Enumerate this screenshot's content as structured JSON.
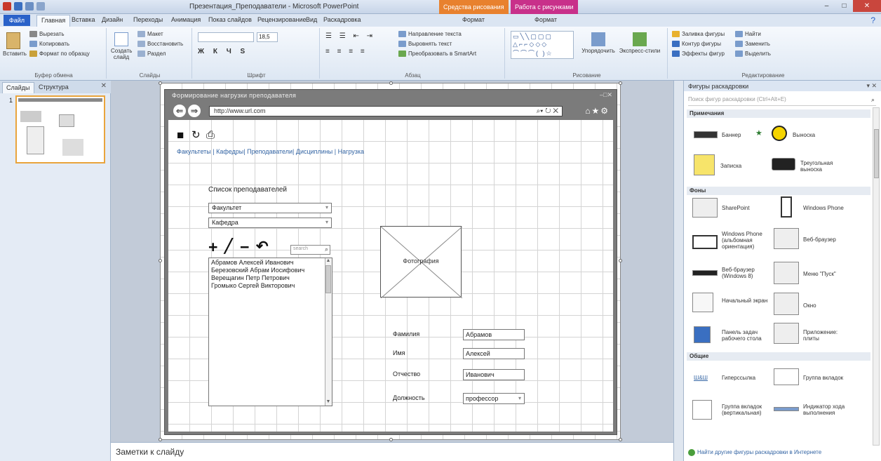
{
  "window": {
    "title": "Презентация_Преподаватели - Microsoft PowerPoint",
    "min": "–",
    "max": "□",
    "close": "✕"
  },
  "context_tabs": [
    "Средства рисования",
    "Работа с рисунками"
  ],
  "tabs": [
    "Файл",
    "Главная",
    "Вставка",
    "Дизайн",
    "Переходы",
    "Анимация",
    "Показ слайдов",
    "Рецензирование",
    "Вид",
    "Раскадровка",
    "Формат",
    "Формат"
  ],
  "ribbon": {
    "clipboard": {
      "label": "Буфер обмена",
      "paste": "Вставить",
      "cut": "Вырезать",
      "copy": "Копировать",
      "format": "Формат по образцу"
    },
    "slides": {
      "label": "Слайды",
      "create": "Создать слайд",
      "layout": "Макет",
      "reset": "Восстановить",
      "section": "Раздел"
    },
    "font": {
      "label": "Шрифт",
      "size": "18,5"
    },
    "paragraph": {
      "label": "Абзац",
      "direction": "Направление текста",
      "align": "Выровнять текст",
      "smartart": "Преобразовать в SmartArt"
    },
    "drawing": {
      "label": "Рисование",
      "arrange": "Упорядочить",
      "styles": "Экспресс-стили"
    },
    "shape_fmt": {
      "fill": "Заливка фигуры",
      "outline": "Контур фигуры",
      "effects": "Эффекты фигур"
    },
    "editing": {
      "label": "Редактирование",
      "find": "Найти",
      "replace": "Заменить",
      "select": "Выделить"
    }
  },
  "left_panel": {
    "tab_slides": "Слайды",
    "tab_outline": "Структура",
    "slide_number": "1"
  },
  "mockup": {
    "window_title": "Формирование нагрузки преподавателя",
    "url": "http://www.url.com",
    "links": "Факультеты | Кафедры| Преподаватели| Дисциплины | Нагрузка",
    "list_title": "Список преподавателей",
    "combo_faculty": "Факультет",
    "combo_department": "Кафедра",
    "search_placeholder": "search",
    "teachers": [
      "Абрамов Алексей Иванович",
      "Березовский Абрам Иосифович",
      "Верещагин Петр Петрович",
      "Громыко Сергей Викторович"
    ],
    "photo_label": "Фотография",
    "fields": [
      {
        "label": "Фамилия",
        "value": "Абрамов"
      },
      {
        "label": "Имя",
        "value": "Алексей"
      },
      {
        "label": "Отчество",
        "value": "Иванович"
      },
      {
        "label": "Должность",
        "value": "профессор"
      }
    ]
  },
  "notes": "Заметки к слайду",
  "right_panel": {
    "title": "Фигуры раскадровки",
    "search_placeholder": "Поиск фигур раскадровки (Ctrl+Alt+E)",
    "categories": [
      "Примечания",
      "Фоны",
      "Общие"
    ],
    "shapes": {
      "banner": "Баннер",
      "callout": "Выноска",
      "note": "Записка",
      "triangle_callout": "Треугольная выноска",
      "sharepoint": "SharePoint",
      "windows_phone": "Windows Phone",
      "wp_landscape": "Windows Phone (альбомная ориентация)",
      "web_browser": "Веб-браузер",
      "web_browser_8": "Веб-браузер (Windows 8)",
      "start_menu": "Меню \"Пуск\"",
      "start_screen": "Начальный экран",
      "window": "Окно",
      "taskbar": "Панель задач рабочего стола",
      "app_tiles": "Приложение: плиты",
      "hyperlink": "Гиперссылка",
      "tab_group": "Группа вкладок",
      "vtab_group": "Группа вкладок (вертикальная)",
      "progress": "Индикатор хода выполнения"
    },
    "footer": "Найти другие фигуры раскадровки в Интернете"
  },
  "colors": {
    "accent": "#2a62c9",
    "highlight": "#e9a43c",
    "browser_frame": "#7b7b7b"
  }
}
